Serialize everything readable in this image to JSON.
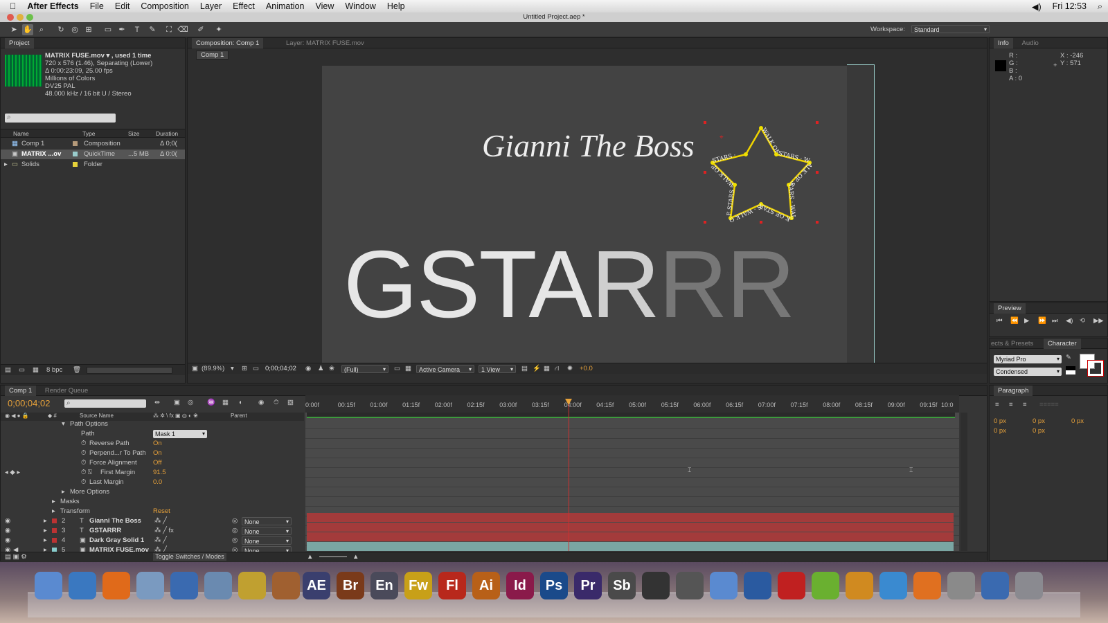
{
  "menubar": {
    "app_name": "After Effects",
    "items": [
      "File",
      "Edit",
      "Composition",
      "Layer",
      "Effect",
      "Animation",
      "View",
      "Window",
      "Help"
    ],
    "clock": "Fri 12:53"
  },
  "window": {
    "title": "Untitled Project.aep *"
  },
  "toolbar": {
    "workspace_label": "Workspace:",
    "workspace_value": "Standard"
  },
  "project": {
    "tab": "Project",
    "footage_name": "MATRIX FUSE.mov ▾ , used 1 time",
    "footage_info": [
      "720 x 576 (1.46), Separating (Lower)",
      "Δ 0:00:23:09, 25.00 fps",
      "Millions of Colors",
      "DV25 PAL",
      "48.000 kHz / 16 bit U / Stereo"
    ],
    "columns": [
      "Name",
      "Type",
      "Size",
      "Duration"
    ],
    "items": [
      {
        "name": "Comp 1",
        "type": "Composition",
        "size": "",
        "duration": "Δ 0;0("
      },
      {
        "name": "MATRIX ...ov",
        "type": "QuickTime",
        "size": "...5 MB",
        "duration": "Δ 0:0("
      },
      {
        "name": "Solids",
        "type": "Folder",
        "size": "",
        "duration": ""
      }
    ],
    "bpc": "8 bpc"
  },
  "composition": {
    "tab": "Composition: Comp 1",
    "layer_tab": "Layer: MATRIX FUSE.mov",
    "breadcrumb": "Comp 1",
    "title_text": "Gianni The Boss",
    "big_text_white": "GSTA",
    "big_text_mid": "R",
    "big_text_gray": "RR",
    "path_text": "WALK OF STARS · WALK OF STARS · WALK OF STARS · WALK OF STARS · WALK OF STARS ·",
    "zoom": "(89.9%)",
    "timecode": "0;00;04;02",
    "resolution": "(Full)",
    "camera": "Active Camera",
    "view": "1 View",
    "exposure": "+0.0"
  },
  "info": {
    "tab_info": "Info",
    "tab_audio": "Audio",
    "r": "R :",
    "g": "G :",
    "b": "B :",
    "a": "A : 0",
    "x": "X : -246",
    "y": "Y : 571"
  },
  "preview": {
    "tab": "Preview"
  },
  "effects": {
    "tab": "ects & Presets"
  },
  "character": {
    "tab": "Character",
    "font": "Myriad Pro",
    "style": "Condensed"
  },
  "paragraph": {
    "tab": "Paragraph",
    "values": [
      "0 px",
      "0 px",
      "0 px",
      "0 px",
      "0 px"
    ]
  },
  "timeline": {
    "tab": "Comp 1",
    "render_tab": "Render Queue",
    "timecode": "0;00;04;02",
    "ruler": [
      "0:00f",
      "00:15f",
      "01:00f",
      "01:15f",
      "02:00f",
      "02:15f",
      "03:00f",
      "03:15f",
      "04:00f",
      "04:15f",
      "05:00f",
      "05:15f",
      "06:00f",
      "06:15f",
      "07:00f",
      "07:15f",
      "08:00f",
      "08:15f",
      "09:00f",
      "09:15f",
      "10:0"
    ],
    "col_source": "Source Name",
    "col_parent": "Parent",
    "props": [
      {
        "label": "Path Options",
        "value": "",
        "indent": 0
      },
      {
        "label": "Path",
        "value": "Mask 1",
        "indent": 1
      },
      {
        "label": "Reverse Path",
        "value": "On",
        "indent": 2
      },
      {
        "label": "Perpend...r To Path",
        "value": "On",
        "indent": 2
      },
      {
        "label": "Force Alignment",
        "value": "Off",
        "indent": 2
      },
      {
        "label": "First Margin",
        "value": "91.5",
        "indent": 3
      },
      {
        "label": "Last Margin",
        "value": "0.0",
        "indent": 2
      },
      {
        "label": "More Options",
        "value": "",
        "indent": 0
      },
      {
        "label": "Masks",
        "value": "",
        "indent": -1
      },
      {
        "label": "Transform",
        "value": "Reset",
        "indent": -1
      }
    ],
    "layers": [
      {
        "num": "2",
        "name": "Gianni The Boss",
        "parent": "None",
        "color": "#b33"
      },
      {
        "num": "3",
        "name": "GSTARRR",
        "parent": "None",
        "color": "#b33"
      },
      {
        "num": "4",
        "name": "Dark Gray Solid 1",
        "parent": "None",
        "color": "#b33"
      },
      {
        "num": "5",
        "name": "MATRIX FUSE.mov",
        "parent": "None",
        "color": "#8cc"
      }
    ],
    "toggle_label": "Toggle Switches / Modes"
  },
  "dock": [
    "AE",
    "Br",
    "En",
    "Fw",
    "Fl",
    "Ai",
    "Id",
    "Ps",
    "Pr",
    "Sb"
  ]
}
